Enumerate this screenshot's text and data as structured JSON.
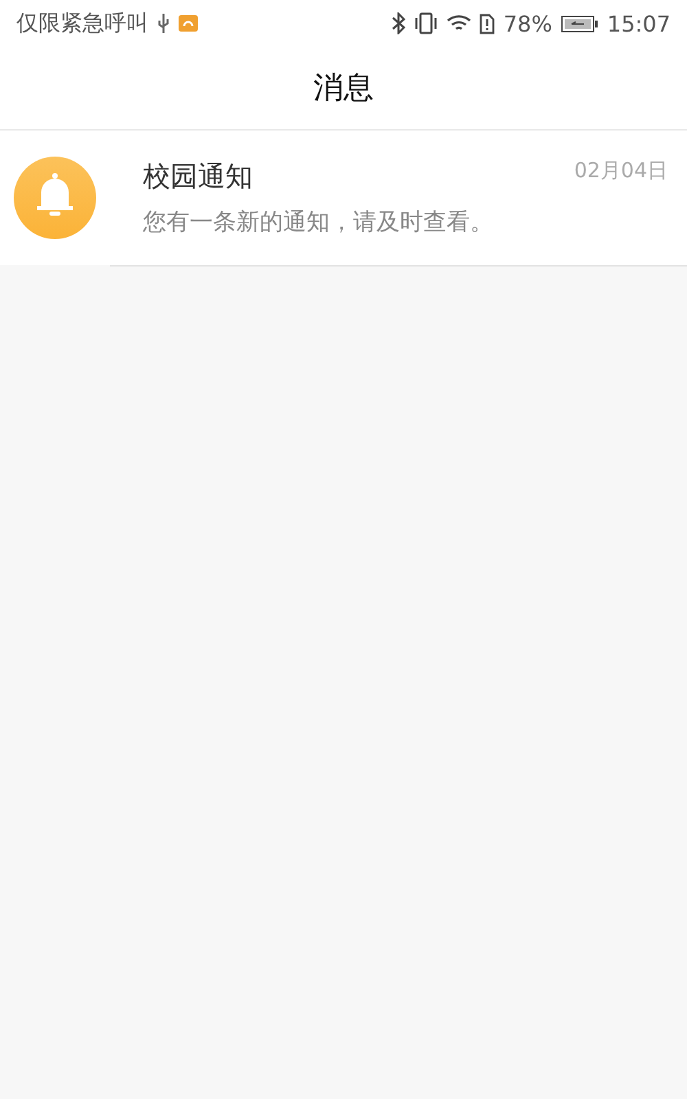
{
  "status_bar": {
    "carrier": "仅限紧急呼叫",
    "battery_text": "78%",
    "time": "15:07"
  },
  "header": {
    "title": "消息"
  },
  "messages": [
    {
      "title": "校园通知",
      "preview": "您有一条新的通知，请及时查看。",
      "date": "02月04日"
    }
  ]
}
